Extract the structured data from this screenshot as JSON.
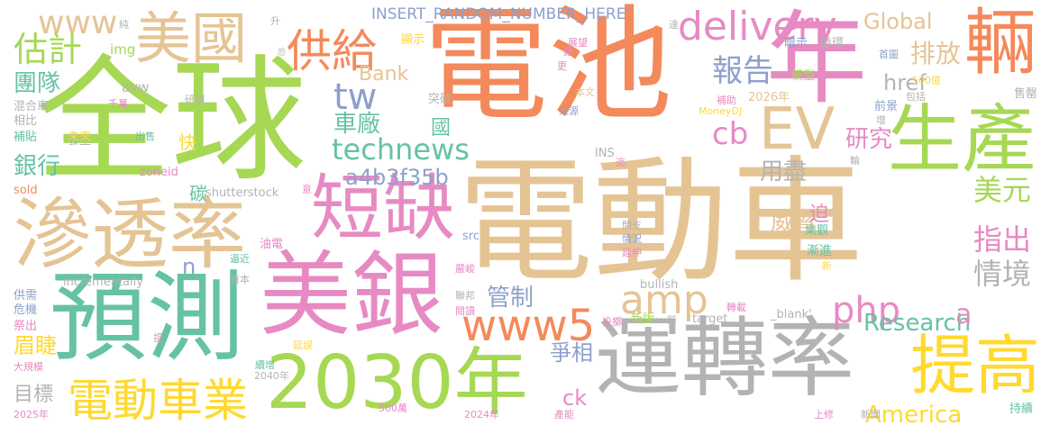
{
  "palette": {
    "orange": "#f4895b",
    "green": "#a6d854",
    "pink": "#e78ac3",
    "tan": "#e5c494",
    "gray": "#b3b3b3",
    "blue": "#8da0cb",
    "yellow": "#ffd92f",
    "teal": "#66c2a5"
  },
  "words": [
    {
      "id": "w-dian-dong-che",
      "text": "電動車",
      "color": "#e5c494"
    },
    {
      "id": "w-dian-chi",
      "text": "電池",
      "color": "#f4895b"
    },
    {
      "id": "w-quan-qiu",
      "text": "全球",
      "color": "#a6d854"
    },
    {
      "id": "w-nian",
      "text": "年",
      "color": "#e78ac3"
    },
    {
      "id": "w-yu-ce",
      "text": "預測",
      "color": "#66c2a5"
    },
    {
      "id": "w-mei-yin",
      "text": "美銀",
      "color": "#e78ac3"
    },
    {
      "id": "w-yun-zhuan-lv",
      "text": "運轉率",
      "color": "#b3b3b3"
    },
    {
      "id": "w-2030",
      "text": "2030年",
      "color": "#a6d854"
    },
    {
      "id": "w-shen-tou-lv",
      "text": "滲透率",
      "color": "#e5c494"
    },
    {
      "id": "w-duan-que",
      "text": "短缺",
      "color": "#e78ac3"
    },
    {
      "id": "w-sheng-chan",
      "text": "生產",
      "color": "#a6d854"
    },
    {
      "id": "w-liang",
      "text": "輛",
      "color": "#f4895b"
    },
    {
      "id": "w-ev",
      "text": "EV",
      "color": "#e5c494"
    },
    {
      "id": "w-mei-guo",
      "text": "美國",
      "color": "#e5c494"
    },
    {
      "id": "w-ti-gao",
      "text": "提高",
      "color": "#ffd92f"
    },
    {
      "id": "w-dian-dong-che-ye",
      "text": "電動車業",
      "color": "#ffd92f"
    },
    {
      "id": "w-www5",
      "text": "www5",
      "color": "#f4895b"
    },
    {
      "id": "w-gong-gei",
      "text": "供給",
      "color": "#f4895b"
    },
    {
      "id": "w-technews",
      "text": "technews",
      "color": "#66c2a5"
    },
    {
      "id": "w-delivery",
      "text": "delivery",
      "color": "#e78ac3"
    },
    {
      "id": "w-www",
      "text": "www",
      "color": "#e5c494"
    },
    {
      "id": "w-gu-ji",
      "text": "估計",
      "color": "#a6d854"
    },
    {
      "id": "w-amp",
      "text": "amp",
      "color": "#e5c494"
    },
    {
      "id": "w-php",
      "text": "php",
      "color": "#e78ac3"
    },
    {
      "id": "w-bao-gao",
      "text": "報告",
      "color": "#8da0cb"
    },
    {
      "id": "w-cb",
      "text": "cb",
      "color": "#e78ac3"
    },
    {
      "id": "w-tw",
      "text": "tw",
      "color": "#8da0cb"
    },
    {
      "id": "w-america",
      "text": "America",
      "color": "#ffd92f"
    },
    {
      "id": "w-research",
      "text": "Research",
      "color": "#66c2a5"
    },
    {
      "id": "w-global",
      "text": "Global",
      "color": "#e5c494"
    },
    {
      "id": "w-insert",
      "text": "INSERT_RANDOM_NUMBER_HERE'",
      "color": "#8da0cb"
    },
    {
      "id": "w-pai-fang",
      "text": "排放",
      "color": "#e5c494"
    },
    {
      "id": "w-href",
      "text": "href",
      "color": "#b3b3b3"
    },
    {
      "id": "w-mei-yuan",
      "text": "美元",
      "color": "#a6d854"
    },
    {
      "id": "w-zhi-chu",
      "text": "指出",
      "color": "#e78ac3"
    },
    {
      "id": "w-qing-jing",
      "text": "情境",
      "color": "#b3b3b3"
    },
    {
      "id": "w-a4b3f35b",
      "text": "a4b3f35b",
      "color": "#8da0cb"
    },
    {
      "id": "w-tuan-dui",
      "text": "團隊",
      "color": "#66c2a5"
    },
    {
      "id": "w-yin-hang",
      "text": "銀行",
      "color": "#66c2a5"
    },
    {
      "id": "w-che-chang",
      "text": "車廠",
      "color": "#66c2a5"
    },
    {
      "id": "w-yan-jiu",
      "text": "研究",
      "color": "#e78ac3"
    },
    {
      "id": "w-yong-jin",
      "text": "用盡",
      "color": "#b3b3b3"
    },
    {
      "id": "w-wei-xie",
      "text": "威脅",
      "color": "#e5c494"
    },
    {
      "id": "w-guan-zhi",
      "text": "管制",
      "color": "#8da0cb"
    },
    {
      "id": "w-zheng-xiang",
      "text": "爭相",
      "color": "#8da0cb"
    },
    {
      "id": "w-mei-jie",
      "text": "眉睫",
      "color": "#ffd92f"
    },
    {
      "id": "w-mu-biao",
      "text": "目標",
      "color": "#b3b3b3"
    },
    {
      "id": "w-bank",
      "text": "Bank",
      "color": "#e5c494"
    },
    {
      "id": "w-ck",
      "text": "ck",
      "color": "#e78ac3"
    },
    {
      "id": "w-a",
      "text": "a",
      "color": "#e78ac3"
    },
    {
      "id": "w-n",
      "text": "n",
      "color": "#8da0cb"
    },
    {
      "id": "w-kuai",
      "text": "快",
      "color": "#ffd92f"
    },
    {
      "id": "w-tan",
      "text": "碳",
      "color": "#66c2a5"
    },
    {
      "id": "w-guo",
      "text": "國",
      "color": "#66c2a5"
    },
    {
      "id": "w-po",
      "text": "迫",
      "color": "#e78ac3"
    },
    {
      "id": "w-jian-jin",
      "text": "漸進",
      "color": "#66c2a5"
    },
    {
      "id": "w-img",
      "text": "img",
      "color": "#a6d854"
    },
    {
      "id": "w-avw",
      "text": "avw",
      "color": "#b3b3b3"
    },
    {
      "id": "w-hun-he-che",
      "text": "混合車",
      "color": "#b3b3b3"
    },
    {
      "id": "w-xiang-bi",
      "text": "相比",
      "color": "#b3b3b3"
    },
    {
      "id": "w-bu-tie",
      "text": "補貼",
      "color": "#66c2a5"
    },
    {
      "id": "w-fa-sheng",
      "text": "發生",
      "color": "#b3b3b3"
    },
    {
      "id": "w-sold",
      "text": "sold",
      "color": "#f4895b"
    },
    {
      "id": "w-qian-wan",
      "text": "千萬",
      "color": "#e78ac3"
    },
    {
      "id": "w-wei-lai",
      "text": "未來",
      "color": "#ffd92f"
    },
    {
      "id": "w-chu-shou",
      "text": "出售",
      "color": "#66c2a5"
    },
    {
      "id": "w-zoneid",
      "text": "zoneid",
      "color": "#e78ac3"
    },
    {
      "id": "w-shutterstock",
      "text": "shutterstock",
      "color": "#b3b3b3"
    },
    {
      "id": "w-incrementally",
      "text": "incrementally",
      "color": "#b3b3b3"
    },
    {
      "id": "w-yan-tiao",
      "text": "研調",
      "color": "#b3b3b3"
    },
    {
      "id": "w-tu-po",
      "text": "突破",
      "color": "#b3b3b3"
    },
    {
      "id": "w-gong-xu",
      "text": "供需",
      "color": "#8da0cb"
    },
    {
      "id": "w-wei-ji",
      "text": "危機",
      "color": "#8da0cb"
    },
    {
      "id": "w-ji-chu",
      "text": "祭出",
      "color": "#e78ac3"
    },
    {
      "id": "w-ti",
      "text": "提",
      "color": "#e78ac3"
    },
    {
      "id": "w-da-gui-mo",
      "text": "大規模",
      "color": "#e78ac3"
    },
    {
      "id": "w-2025",
      "text": "2025年",
      "color": "#e78ac3"
    },
    {
      "id": "w-2040",
      "text": "2040年",
      "color": "#b3b3b3"
    },
    {
      "id": "w-xu-zeng",
      "text": "續增",
      "color": "#66c2a5"
    },
    {
      "id": "w-yan-wu",
      "text": "延誤",
      "color": "#ffd92f"
    },
    {
      "id": "w-bi-jin",
      "text": "逼近",
      "color": "#66c2a5"
    },
    {
      "id": "w-you-dian",
      "text": "油電",
      "color": "#e78ac3"
    },
    {
      "id": "w-zi-ben",
      "text": "資本",
      "color": "#b3b3b3"
    },
    {
      "id": "w-500-wan",
      "text": "500萬",
      "color": "#e78ac3"
    },
    {
      "id": "w-2024",
      "text": "2024年",
      "color": "#e78ac3"
    },
    {
      "id": "w-chan-neng",
      "text": "產能",
      "color": "#e78ac3"
    },
    {
      "id": "w-shang-xiu",
      "text": "上修",
      "color": "#e78ac3"
    },
    {
      "id": "w-xin-wen",
      "text": "新聞",
      "color": "#b3b3b3"
    },
    {
      "id": "w-chi-xu",
      "text": "持續",
      "color": "#66c2a5"
    },
    {
      "id": "w-zhuan-zai",
      "text": "轉載",
      "color": "#e78ac3"
    },
    {
      "id": "w-tou-xie",
      "text": "投擲",
      "color": "#e78ac3"
    },
    {
      "id": "w-xin-ban",
      "text": "新版",
      "color": "#a6d854"
    },
    {
      "id": "w-qian",
      "text": "前",
      "color": "#b3b3b3"
    },
    {
      "id": "w-target",
      "text": "target",
      "color": "#b3b3b3"
    },
    {
      "id": "w-blank",
      "text": "_blank'",
      "color": "#b3b3b3"
    },
    {
      "id": "w-yue-du",
      "text": "閱讀",
      "color": "#e78ac3"
    },
    {
      "id": "w-lian-bang",
      "text": "聯邦",
      "color": "#b3b3b3"
    },
    {
      "id": "w-yan-jun",
      "text": "嚴峻",
      "color": "#e78ac3"
    },
    {
      "id": "w-src",
      "text": "src",
      "color": "#8da0cb"
    },
    {
      "id": "w-bullish",
      "text": "bullish",
      "color": "#b3b3b3"
    },
    {
      "id": "w-qing-kuang",
      "text": "情況",
      "color": "#8da0cb"
    },
    {
      "id": "w-yan-shen",
      "text": "延伸",
      "color": "#e78ac3"
    },
    {
      "id": "w-kai-zhi",
      "text": "開支",
      "color": "#b3b3b3"
    },
    {
      "id": "w-le-guan",
      "text": "樂觀",
      "color": "#66c2a5"
    },
    {
      "id": "w-xin",
      "text": "新",
      "color": "#ffd92f"
    },
    {
      "id": "w-yi",
      "text": "意",
      "color": "#e78ac3"
    },
    {
      "id": "w-qi",
      "text": "迄",
      "color": "#e78ac3"
    },
    {
      "id": "w-lun",
      "text": "輪",
      "color": "#b3b3b3"
    },
    {
      "id": "w-ins",
      "text": "INS",
      "color": "#b3b3b3"
    },
    {
      "id": "w-ben-wen",
      "text": "本文",
      "color": "#e5c494"
    },
    {
      "id": "w-lai-yuan",
      "text": "來源",
      "color": "#8da0cb"
    },
    {
      "id": "w-moneydj",
      "text": "MoneyDJ",
      "color": "#ffd92f"
    },
    {
      "id": "w-bu-zhu",
      "text": "補助",
      "color": "#e78ac3"
    },
    {
      "id": "w-2026",
      "text": "2026年",
      "color": "#e5c494"
    },
    {
      "id": "w-mo-xing",
      "text": "模型",
      "color": "#a6d854"
    },
    {
      "id": "w-an-shi",
      "text": "暗示",
      "color": "#8da0cb"
    },
    {
      "id": "w-xun-huan",
      "text": "循環",
      "color": "#b3b3b3"
    },
    {
      "id": "w-shou-tu",
      "text": "首圖",
      "color": "#8da0cb"
    },
    {
      "id": "w-500-yi",
      "text": "500億",
      "color": "#ffd92f"
    },
    {
      "id": "w-bao-kuo",
      "text": "包括",
      "color": "#b3b3b3"
    },
    {
      "id": "w-qian-jing",
      "text": "前景",
      "color": "#8da0cb"
    },
    {
      "id": "w-shou-qing",
      "text": "售罄",
      "color": "#b3b3b3"
    },
    {
      "id": "w-zeng",
      "text": "增",
      "color": "#b3b3b3"
    },
    {
      "id": "w-zhan-wang",
      "text": "展望",
      "color": "#e78ac3"
    },
    {
      "id": "w-li",
      "text": "鋰",
      "color": "#e78ac3"
    },
    {
      "id": "w-geng",
      "text": "更",
      "color": "#e78ac3"
    },
    {
      "id": "w-xian-shi",
      "text": "顯示",
      "color": "#ffd92f"
    },
    {
      "id": "w-da",
      "text": "達",
      "color": "#b3b3b3"
    },
    {
      "id": "w-sheng",
      "text": "升",
      "color": "#b3b3b3"
    },
    {
      "id": "w-kong",
      "text": "恐",
      "color": "#b3b3b3"
    },
    {
      "id": "w-chun",
      "text": "純",
      "color": "#b3b3b3"
    }
  ]
}
